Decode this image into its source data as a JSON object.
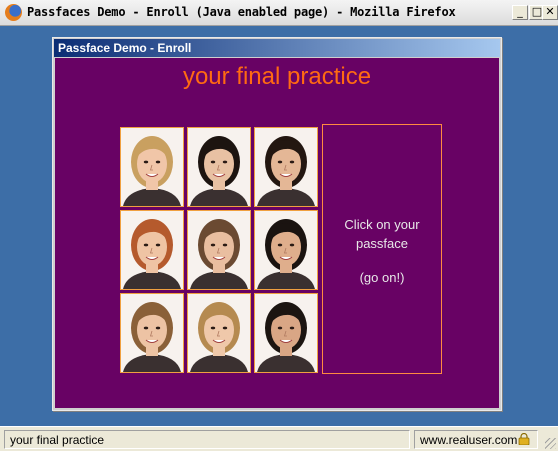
{
  "window": {
    "title": "Passfaces Demo - Enroll (Java enabled page) - Mozilla Firefox",
    "buttons": [
      "minimize",
      "maximize",
      "close"
    ]
  },
  "applet": {
    "title": "Passface Demo - Enroll",
    "heading": "your final practice",
    "instruction_line1": "Click on your passface",
    "instruction_line2": "(go on!)",
    "colors": {
      "background": "#680264",
      "heading": "#ff6a12",
      "frame": "#ff8a40"
    },
    "faces": [
      {
        "name": "face-1",
        "hair": "#c9a060",
        "skin": "#f1c6a8"
      },
      {
        "name": "face-2",
        "hair": "#1c1410",
        "skin": "#e8c1a3"
      },
      {
        "name": "face-3",
        "hair": "#231711",
        "skin": "#e4b796"
      },
      {
        "name": "face-4",
        "hair": "#b55a2d",
        "skin": "#efc4a4"
      },
      {
        "name": "face-5",
        "hair": "#6b4a32",
        "skin": "#e9bea0"
      },
      {
        "name": "face-6",
        "hair": "#1a1310",
        "skin": "#dfae8c"
      },
      {
        "name": "face-7",
        "hair": "#8a6038",
        "skin": "#edc3a4"
      },
      {
        "name": "face-8",
        "hair": "#b58a50",
        "skin": "#efc8aa"
      },
      {
        "name": "face-9",
        "hair": "#1c1511",
        "skin": "#d9a685"
      }
    ]
  },
  "status": {
    "text": "your final practice",
    "site": "www.realuser.com",
    "lock_icon": "lock-icon"
  }
}
